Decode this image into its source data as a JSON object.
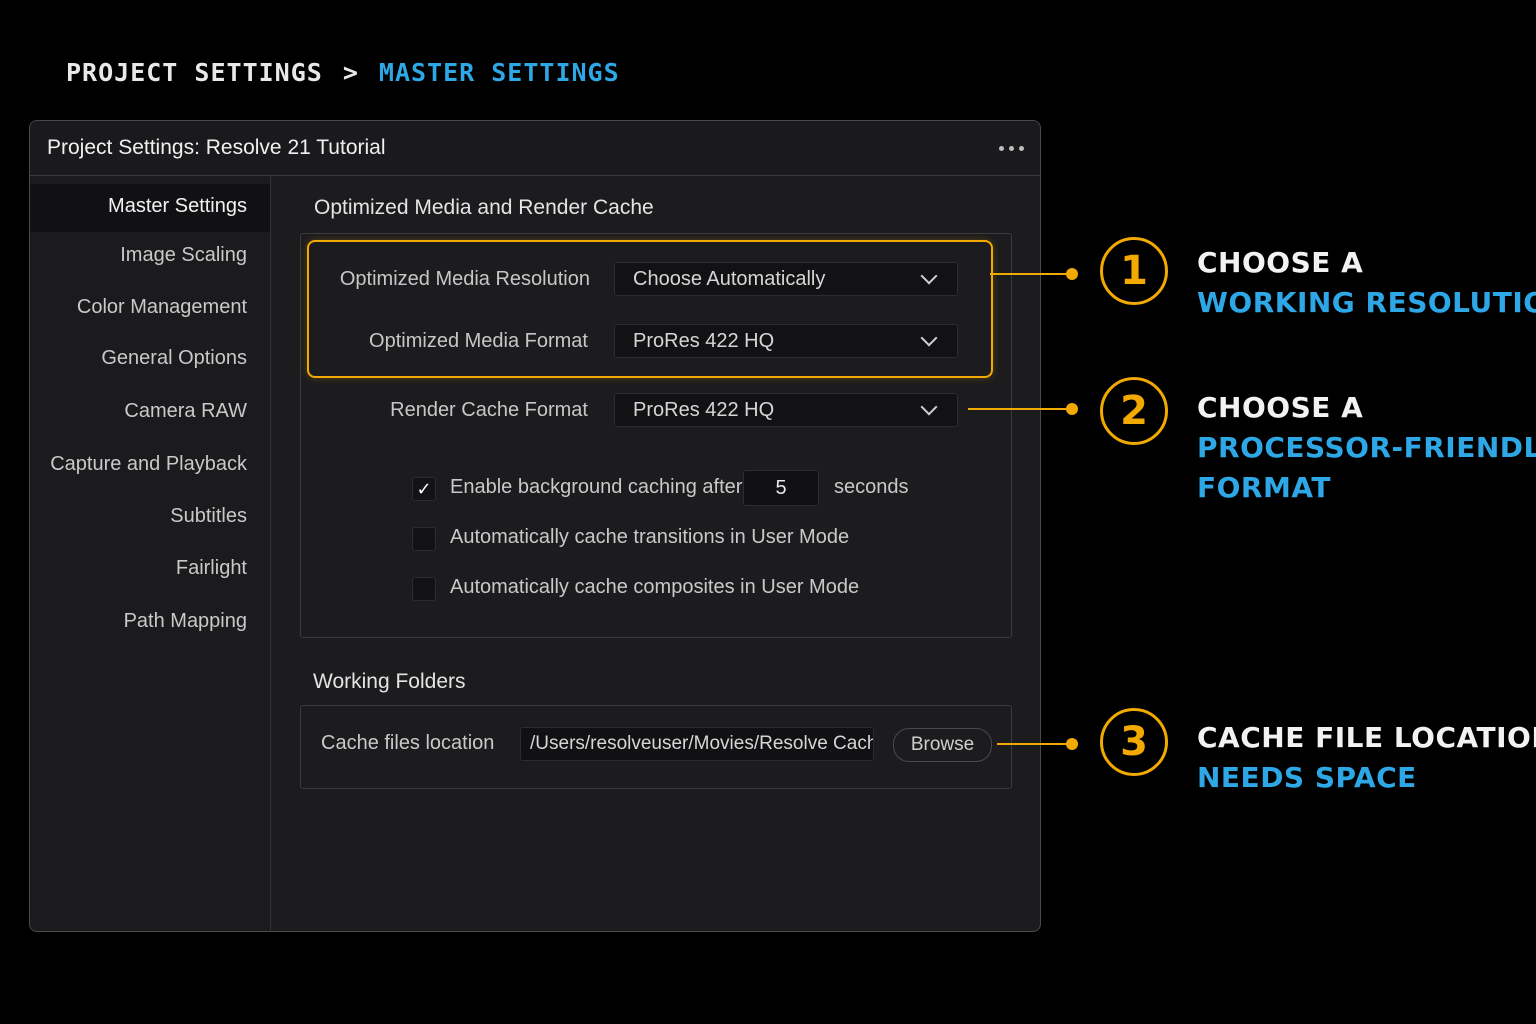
{
  "breadcrumb": {
    "parent": "PROJECT SETTINGS",
    "separator": ">",
    "current": "MASTER SETTINGS"
  },
  "window": {
    "title": "Project Settings:  Resolve 21 Tutorial",
    "menu_icon": "more-horizontal-icon"
  },
  "sidebar": {
    "items": [
      {
        "label": "Master Settings",
        "active": true
      },
      {
        "label": "Image Scaling"
      },
      {
        "label": "Color Management"
      },
      {
        "label": "General Options"
      },
      {
        "label": "Camera RAW"
      },
      {
        "label": "Capture and Playback"
      },
      {
        "label": "Subtitles"
      },
      {
        "label": "Fairlight"
      },
      {
        "label": "Path Mapping"
      }
    ]
  },
  "optimized": {
    "heading": "Optimized Media and Render Cache",
    "resolution_label": "Optimized Media Resolution",
    "resolution_value": "Choose Automatically",
    "format_label": "Optimized Media Format",
    "format_value": "ProRes 422 HQ",
    "render_label": "Render Cache Format",
    "render_value": "ProRes 422 HQ",
    "bg_cache_label": "Enable background caching after",
    "bg_cache_checked": true,
    "bg_cache_seconds": "5",
    "bg_cache_unit": "seconds",
    "transitions_label": "Automatically cache transitions in User Mode",
    "transitions_checked": false,
    "composites_label": "Automatically cache composites in User Mode",
    "composites_checked": false
  },
  "working_folders": {
    "heading": "Working Folders",
    "cache_label": "Cache files location",
    "cache_path": "/Users/resolveuser/Movies/Resolve Cache",
    "browse_label": "Browse"
  },
  "callouts": [
    {
      "number": "1",
      "line1": "CHOOSE A",
      "line2": "WORKING RESOLUTION"
    },
    {
      "number": "2",
      "line1": "CHOOSE A",
      "line2": "PROCESSOR-FRIENDLY",
      "line3": "FORMAT"
    },
    {
      "number": "3",
      "line1": "CACHE FILE LOCATION",
      "line2": "NEEDS SPACE"
    }
  ],
  "colors": {
    "accent_orange": "#f2a900",
    "accent_blue": "#2ea7e6",
    "background": "#000000",
    "panel": "#1c1c1e"
  }
}
